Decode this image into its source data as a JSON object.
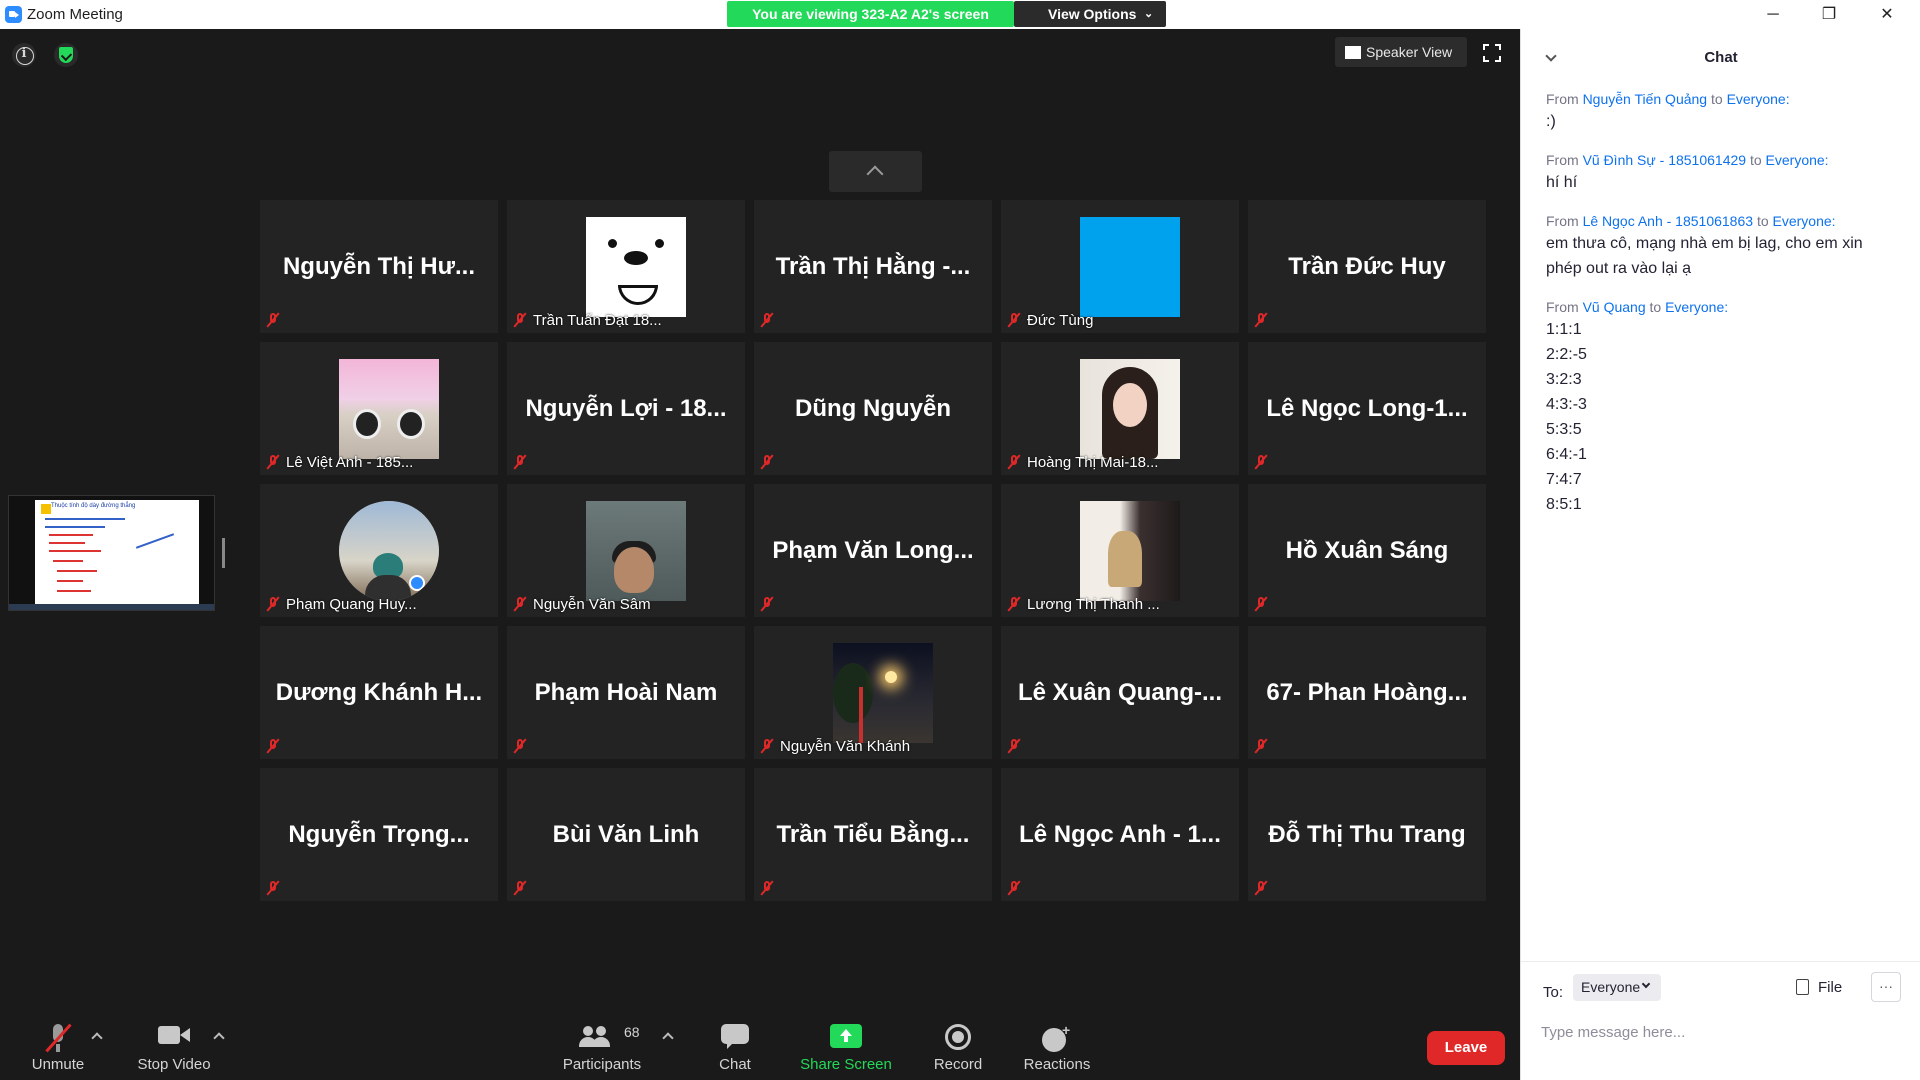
{
  "window": {
    "title": "Zoom Meeting",
    "controls": {
      "minimize": "─",
      "maximize": "❐",
      "close": "✕"
    }
  },
  "banner": {
    "viewing": "You are viewing 323-A2 A2's screen",
    "view_options": "View Options"
  },
  "topbar": {
    "speaker_view": "Speaker View"
  },
  "tiles": [
    {
      "name": "Nguyễn Thị Hư...",
      "label": "",
      "photo": ""
    },
    {
      "name": "",
      "label": "Trần Tuấn Đạt 18...",
      "photo": "bear"
    },
    {
      "name": "Trần Thị Hằng -...",
      "label": "",
      "photo": ""
    },
    {
      "name": "",
      "label": "Đức Tùng",
      "photo": "blue"
    },
    {
      "name": "Trần Đức Huy",
      "label": "",
      "photo": ""
    },
    {
      "name": "",
      "label": "Lê Việt Anh - 185...",
      "photo": "cat"
    },
    {
      "name": "Nguyễn Lợi - 18...",
      "label": "",
      "photo": ""
    },
    {
      "name": "Dũng Nguyễn",
      "label": "",
      "photo": ""
    },
    {
      "name": "",
      "label": "Hoàng Thị Mai-18...",
      "photo": "girl"
    },
    {
      "name": "Lê Ngọc Long-1...",
      "label": "",
      "photo": ""
    },
    {
      "name": "",
      "label": "Phạm Quang Huy...",
      "photo": "round"
    },
    {
      "name": "",
      "label": "Nguyễn Văn Sâm",
      "photo": "boy"
    },
    {
      "name": "Phạm Văn Long...",
      "label": "",
      "photo": ""
    },
    {
      "name": "",
      "label": "Lương Thị Thanh ...",
      "photo": "side"
    },
    {
      "name": "Hồ Xuân Sáng",
      "label": "",
      "photo": ""
    },
    {
      "name": "Dương Khánh H...",
      "label": "",
      "photo": ""
    },
    {
      "name": "Phạm Hoài Nam",
      "label": "",
      "photo": ""
    },
    {
      "name": "",
      "label": "Nguyễn Văn Khánh",
      "photo": "night"
    },
    {
      "name": "Lê Xuân Quang-...",
      "label": "",
      "photo": ""
    },
    {
      "name": "67- Phan Hoàng...",
      "label": "",
      "photo": ""
    },
    {
      "name": "Nguyễn Trọng...",
      "label": "",
      "photo": ""
    },
    {
      "name": "Bùi Văn Linh",
      "label": "",
      "photo": ""
    },
    {
      "name": "Trần Tiểu Bằng...",
      "label": "",
      "photo": ""
    },
    {
      "name": "Lê Ngọc Anh - 1...",
      "label": "",
      "photo": ""
    },
    {
      "name": "Đỗ Thị Thu Trang",
      "label": "",
      "photo": ""
    }
  ],
  "toolbar": {
    "unmute": "Unmute",
    "stop_video": "Stop Video",
    "participants": "Participants",
    "participants_count": "68",
    "chat": "Chat",
    "share_screen": "Share Screen",
    "record": "Record",
    "reactions": "Reactions",
    "leave": "Leave"
  },
  "chat": {
    "title": "Chat",
    "messages": [
      {
        "from_prefix": "From",
        "sender": "Nguyễn Tiến Quảng",
        "to_word": "to",
        "recipient": "Everyone:",
        "lines": [
          ":)"
        ]
      },
      {
        "from_prefix": "From",
        "sender": "Vũ Đình Sự - 1851061429",
        "to_word": "to",
        "recipient": "Everyone:",
        "lines": [
          "hí hí"
        ]
      },
      {
        "from_prefix": "From",
        "sender": "Lê Ngọc Anh - 1851061863",
        "to_word": "to",
        "recipient": "Everyone:",
        "lines": [
          "em thưa cô, mạng nhà em bị lag, cho em xin phép out ra vào lại ạ"
        ]
      },
      {
        "from_prefix": "From",
        "sender": "Vũ Quang",
        "to_word": "to",
        "recipient": "Everyone:",
        "lines": [
          "1:1:1",
          "2:2:-5",
          "3:2:3",
          "4:3:-3",
          "5:3:5",
          "6:4:-1",
          "7:4:7",
          "8:5:1"
        ]
      }
    ],
    "to_label": "To:",
    "to_value": "Everyone",
    "file_label": "File",
    "more_label": "···",
    "input_placeholder": "Type message here..."
  },
  "shared_thumbnail": {
    "title": "Thuộc tính độ dày đường thẳng"
  },
  "colors": {
    "banner_green": "#23d959",
    "leave_red": "#e02828",
    "chat_link_blue": "#0e72ed",
    "muted_red": "#e02828"
  }
}
